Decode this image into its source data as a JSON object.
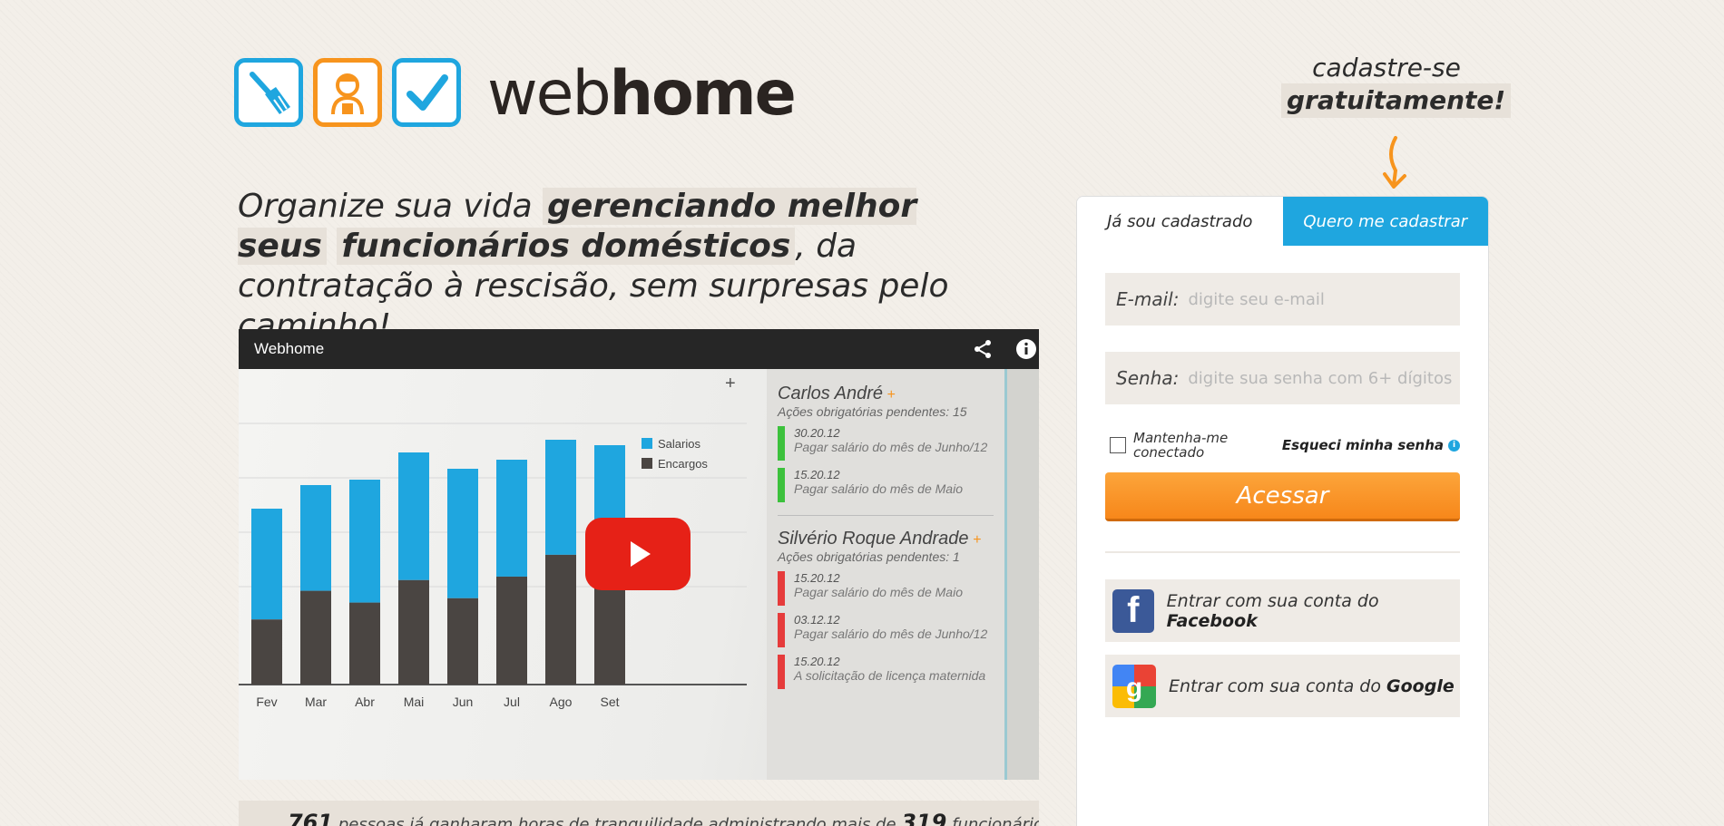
{
  "brand": {
    "name_light": "web",
    "name_bold": "home",
    "icons": [
      "broom-icon",
      "maid-icon",
      "checkmark-icon"
    ],
    "colors": {
      "blue": "#1fa6df",
      "orange": "#f7941d"
    }
  },
  "cta": {
    "line1": "cadastre-se",
    "line2": "gratuitamente!"
  },
  "headline": {
    "part1": "Organize sua vida ",
    "highlight1": "gerenciando melhor seus",
    "highlight2": "funcionários domésticos",
    "part2": ", da contratação à rescisão, sem surpresas pelo caminho!"
  },
  "video": {
    "title": "Webhome",
    "chart": {
      "legend": [
        "Salarios",
        "Encargos"
      ],
      "months": [
        "Fev",
        "Mar",
        "Abr",
        "Mai",
        "Jun",
        "Jul",
        "Ago",
        "Set"
      ],
      "salarios_share": [
        0.63,
        0.53,
        0.6,
        0.55,
        0.6,
        0.52,
        0.47,
        0.4
      ],
      "colors": {
        "salarios": "#1fa6df",
        "encargos": "#4a4542"
      }
    },
    "people": [
      {
        "name": "Carlos André",
        "pending": "Ações obrigatórias pendentes: 15",
        "tasks": [
          {
            "date": "30.20.12",
            "text": "Pagar salário do mês de Junho/12",
            "color": "#3cc13c"
          },
          {
            "date": "15.20.12",
            "text": "Pagar salário do mês de Maio",
            "color": "#3cc13c"
          }
        ]
      },
      {
        "name": "Silvério Roque Andrade",
        "pending": "Ações obrigatórias pendentes: 1",
        "tasks": [
          {
            "date": "15.20.12",
            "text": "Pagar salário do mês de Maio",
            "color": "#e63b3b"
          },
          {
            "date": "03.12.12",
            "text": "Pagar salário do mês de Junho/12",
            "color": "#e63b3b"
          },
          {
            "date": "15.20.12",
            "text": "A solicitação de licença maternida",
            "color": "#e63b3b"
          }
        ]
      }
    ]
  },
  "stats": {
    "people_count": "761",
    "text1": " pessoas já ganharam horas de tranquilidade administrando mais de ",
    "staff_count": "319",
    "text2": " funcionários"
  },
  "login": {
    "tab_login": "Já sou cadastrado",
    "tab_register": "Quero me cadastrar",
    "email_label": "E-mail:",
    "email_placeholder": "digite seu e-mail",
    "password_label": "Senha:",
    "password_placeholder": "digite sua senha com 6+ dígitos",
    "remember": "Mantenha-me conectado",
    "forgot": "Esqueci minha senha",
    "submit": "Acessar",
    "facebook_prefix": "Entrar com sua conta do ",
    "facebook_name": "Facebook",
    "google_prefix": "Entrar com sua conta do ",
    "google_name": "Google"
  }
}
